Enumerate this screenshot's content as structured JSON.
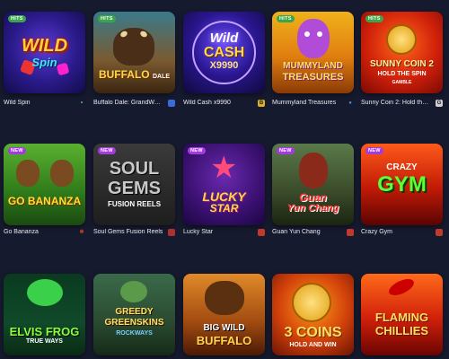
{
  "games": [
    {
      "title": "Wild Spin",
      "badge": "HITS",
      "badge_type": "hits",
      "logo": [
        "WILD",
        "Spin"
      ],
      "provider_icon": "g-circle-icon",
      "provider_glyph": "•",
      "provider_color": "#6ad16a"
    },
    {
      "title": "Buffalo Dale: GrandWays",
      "badge": "HITS",
      "badge_type": "hits",
      "logo": [
        "BUFFALO",
        "DALE"
      ],
      "provider_icon": "provider-square-icon",
      "provider_glyph": "▪",
      "provider_color": "#3b6bd6"
    },
    {
      "title": "Wild Cash x9990",
      "badge": "",
      "badge_type": "",
      "logo": [
        "Wild",
        "CASH",
        "X9990"
      ],
      "provider_icon": "b-square-icon",
      "provider_glyph": "B",
      "provider_color": "#e0b020"
    },
    {
      "title": "Mummyland Treasures",
      "badge": "HITS",
      "badge_type": "hits",
      "logo": [
        "MUMMYLAND",
        "TREASURES"
      ],
      "provider_icon": "provider-dot-icon",
      "provider_glyph": "●",
      "provider_color": "#4a8fe0"
    },
    {
      "title": "Sunny Coin 2: Hold the ...",
      "badge": "HITS",
      "badge_type": "hits",
      "logo": [
        "SUNNY COIN 2",
        "HOLD THE SPIN",
        "GAMBLE"
      ],
      "provider_icon": "g-square-icon",
      "provider_glyph": "G",
      "provider_color": "#d0d0d0"
    },
    {
      "title": "Go Bananza",
      "badge": "NEW",
      "badge_type": "new",
      "logo": [
        "GO BANANZA"
      ],
      "provider_icon": "provider-star-icon",
      "provider_glyph": "✱",
      "provider_color": "#c0392b"
    },
    {
      "title": "Soul Gems Fusion Reels",
      "badge": "NEW",
      "badge_type": "new",
      "logo": [
        "SOUL",
        "GEMS",
        "FUSION REELS"
      ],
      "provider_icon": "provider-red-icon",
      "provider_glyph": "■",
      "provider_color": "#b03030"
    },
    {
      "title": "Lucky Star",
      "badge": "NEW",
      "badge_type": "new",
      "logo": [
        "LUCKY",
        "STAR"
      ],
      "provider_icon": "provider-red-icon",
      "provider_glyph": "■",
      "provider_color": "#c0392b"
    },
    {
      "title": "Guan Yun Chang",
      "badge": "NEW",
      "badge_type": "new",
      "logo": [
        "Guan",
        "Yun Chang"
      ],
      "provider_icon": "provider-red-icon",
      "provider_glyph": "■",
      "provider_color": "#c0392b"
    },
    {
      "title": "Crazy Gym",
      "badge": "NEW",
      "badge_type": "new",
      "logo": [
        "CRAZY",
        "GYM"
      ],
      "provider_icon": "provider-red-icon",
      "provider_glyph": "■",
      "provider_color": "#c0392b"
    },
    {
      "title": "",
      "badge": "",
      "badge_type": "",
      "logo": [
        "ELVIS FROG",
        "TRUE WAYS"
      ],
      "provider_icon": "",
      "provider_glyph": "",
      "provider_color": ""
    },
    {
      "title": "",
      "badge": "",
      "badge_type": "",
      "logo": [
        "GREEDY",
        "GREENSKINS",
        "ROCKWAYS"
      ],
      "provider_icon": "",
      "provider_glyph": "",
      "provider_color": ""
    },
    {
      "title": "",
      "badge": "",
      "badge_type": "",
      "logo": [
        "BIG WILD",
        "BUFFALO"
      ],
      "provider_icon": "",
      "provider_glyph": "",
      "provider_color": ""
    },
    {
      "title": "",
      "badge": "",
      "badge_type": "",
      "logo": [
        "3",
        "COINS",
        "HOLD AND WIN"
      ],
      "provider_icon": "",
      "provider_glyph": "",
      "provider_color": ""
    },
    {
      "title": "",
      "badge": "",
      "badge_type": "",
      "logo": [
        "FLAMING",
        "CHILLIES"
      ],
      "provider_icon": "",
      "provider_glyph": "",
      "provider_color": ""
    }
  ]
}
